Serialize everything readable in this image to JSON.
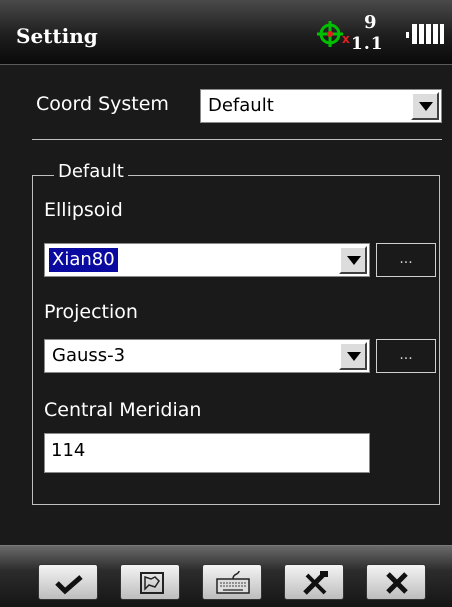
{
  "header": {
    "title": "Setting",
    "gps_status_icon": "gps-crosshair-icon",
    "fix_mark": "x",
    "satellite_count": "9",
    "pdop": "1.1",
    "signal_icon": "signal-bars-icon"
  },
  "form": {
    "coord_system_label": "Coord System",
    "coord_system_value": "Default",
    "group_title": "Default",
    "ellipsoid_label": "Ellipsoid",
    "ellipsoid_value": "Xian80",
    "ellipsoid_more": "...",
    "projection_label": "Projection",
    "projection_value": "Gauss-3",
    "projection_more": "...",
    "central_meridian_label": "Central Meridian",
    "central_meridian_value": "114"
  },
  "toolbar": {
    "buttons": [
      "ok-check-icon",
      "map-icon",
      "keyboard-icon",
      "tools-icon",
      "close-icon"
    ]
  },
  "colors": {
    "background": "#1a1a1a",
    "selection": "#0a0aa0",
    "gps_green": "#00c000",
    "fix_red": "#e02020"
  }
}
